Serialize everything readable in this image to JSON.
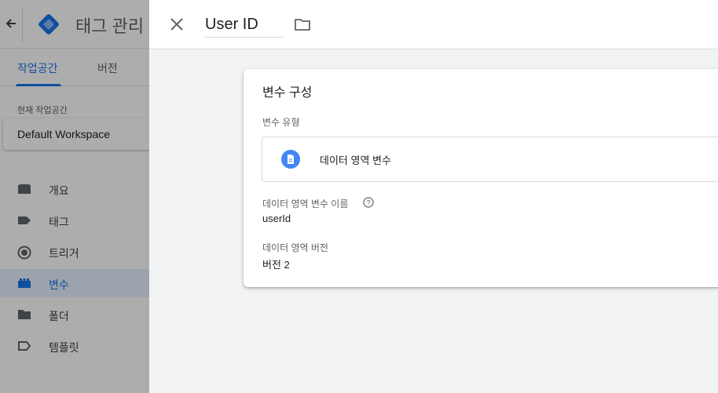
{
  "app": {
    "title": "태그 관리",
    "tabs": [
      {
        "label": "작업공간",
        "active": true
      },
      {
        "label": "버전",
        "active": false
      }
    ],
    "workspace": {
      "label": "현재 작업공간",
      "name": "Default Workspace"
    },
    "nav": [
      {
        "label": "개요",
        "icon": "overview-icon"
      },
      {
        "label": "태그",
        "icon": "tag-icon"
      },
      {
        "label": "트리거",
        "icon": "trigger-icon"
      },
      {
        "label": "변수",
        "icon": "variable-icon",
        "active": true
      },
      {
        "label": "폴더",
        "icon": "folder-icon"
      },
      {
        "label": "템플릿",
        "icon": "template-icon"
      }
    ]
  },
  "panel": {
    "name": "User ID",
    "card": {
      "title": "변수 구성",
      "type_label": "변수 유형",
      "type_value": "데이터 영역 변수",
      "dl_name_label": "데이터 영역 변수 이름",
      "dl_name_value": "userId",
      "dl_version_label": "데이터 영역 버전",
      "dl_version_value": "버전 2"
    }
  },
  "colors": {
    "accent": "#1a73e8",
    "icon_blue": "#4285f4"
  }
}
